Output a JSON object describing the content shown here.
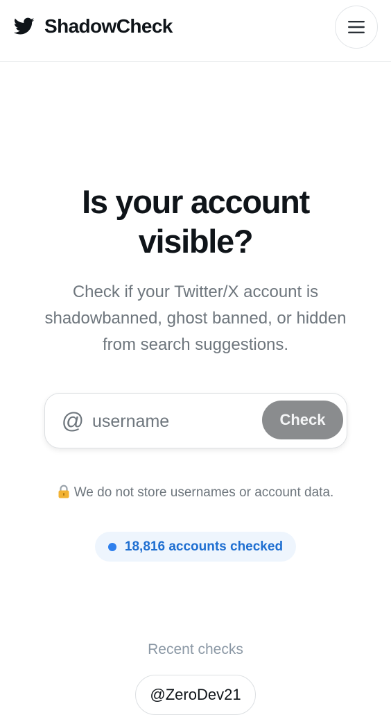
{
  "header": {
    "brand_name": "ShadowCheck",
    "brand_icon": "bird-icon",
    "menu_icon": "hamburger-menu-icon"
  },
  "hero": {
    "title_line1": "Is your account",
    "title_line2": "visible?",
    "subtitle": "Check if your Twitter/X account is shadowbanned, ghost banned, or hidden from search suggestions."
  },
  "search": {
    "at_symbol": "@",
    "placeholder": "username",
    "value": "",
    "button_label": "Check"
  },
  "privacy": {
    "text": "We do not store usernames or account data."
  },
  "stats": {
    "accounts_checked": "18,816 accounts checked"
  },
  "recent": {
    "title": "Recent checks",
    "items": [
      "@ZeroDev21"
    ]
  },
  "colors": {
    "accent_blue": "#1f6fd1",
    "button_gray": "#8a8c8e",
    "text_primary": "#0f1419",
    "text_muted": "#6e767d"
  }
}
